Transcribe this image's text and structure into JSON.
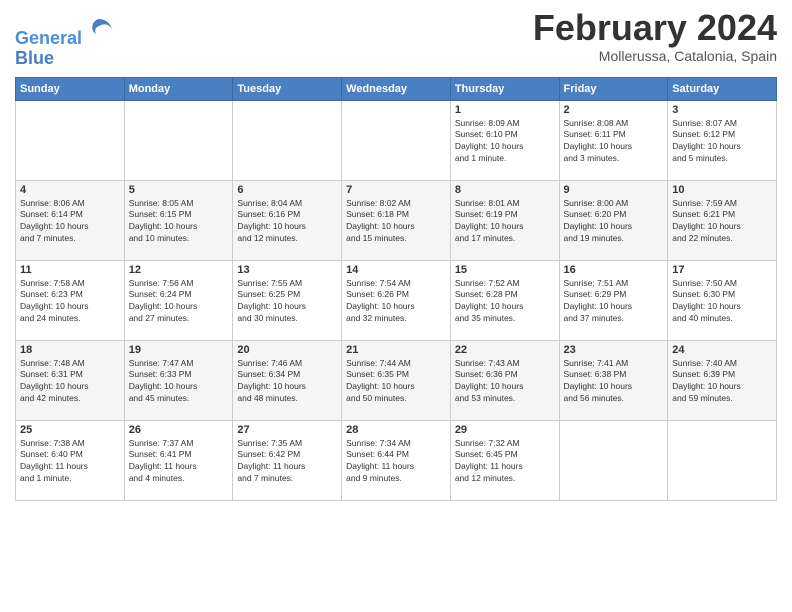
{
  "app": {
    "logo_line1": "General",
    "logo_line2": "Blue"
  },
  "header": {
    "title": "February 2024",
    "subtitle": "Mollerussa, Catalonia, Spain"
  },
  "days_of_week": [
    "Sunday",
    "Monday",
    "Tuesday",
    "Wednesday",
    "Thursday",
    "Friday",
    "Saturday"
  ],
  "weeks": [
    [
      {
        "day": "",
        "info": ""
      },
      {
        "day": "",
        "info": ""
      },
      {
        "day": "",
        "info": ""
      },
      {
        "day": "",
        "info": ""
      },
      {
        "day": "1",
        "info": "Sunrise: 8:09 AM\nSunset: 6:10 PM\nDaylight: 10 hours\nand 1 minute."
      },
      {
        "day": "2",
        "info": "Sunrise: 8:08 AM\nSunset: 6:11 PM\nDaylight: 10 hours\nand 3 minutes."
      },
      {
        "day": "3",
        "info": "Sunrise: 8:07 AM\nSunset: 6:12 PM\nDaylight: 10 hours\nand 5 minutes."
      }
    ],
    [
      {
        "day": "4",
        "info": "Sunrise: 8:06 AM\nSunset: 6:14 PM\nDaylight: 10 hours\nand 7 minutes."
      },
      {
        "day": "5",
        "info": "Sunrise: 8:05 AM\nSunset: 6:15 PM\nDaylight: 10 hours\nand 10 minutes."
      },
      {
        "day": "6",
        "info": "Sunrise: 8:04 AM\nSunset: 6:16 PM\nDaylight: 10 hours\nand 12 minutes."
      },
      {
        "day": "7",
        "info": "Sunrise: 8:02 AM\nSunset: 6:18 PM\nDaylight: 10 hours\nand 15 minutes."
      },
      {
        "day": "8",
        "info": "Sunrise: 8:01 AM\nSunset: 6:19 PM\nDaylight: 10 hours\nand 17 minutes."
      },
      {
        "day": "9",
        "info": "Sunrise: 8:00 AM\nSunset: 6:20 PM\nDaylight: 10 hours\nand 19 minutes."
      },
      {
        "day": "10",
        "info": "Sunrise: 7:59 AM\nSunset: 6:21 PM\nDaylight: 10 hours\nand 22 minutes."
      }
    ],
    [
      {
        "day": "11",
        "info": "Sunrise: 7:58 AM\nSunset: 6:23 PM\nDaylight: 10 hours\nand 24 minutes."
      },
      {
        "day": "12",
        "info": "Sunrise: 7:56 AM\nSunset: 6:24 PM\nDaylight: 10 hours\nand 27 minutes."
      },
      {
        "day": "13",
        "info": "Sunrise: 7:55 AM\nSunset: 6:25 PM\nDaylight: 10 hours\nand 30 minutes."
      },
      {
        "day": "14",
        "info": "Sunrise: 7:54 AM\nSunset: 6:26 PM\nDaylight: 10 hours\nand 32 minutes."
      },
      {
        "day": "15",
        "info": "Sunrise: 7:52 AM\nSunset: 6:28 PM\nDaylight: 10 hours\nand 35 minutes."
      },
      {
        "day": "16",
        "info": "Sunrise: 7:51 AM\nSunset: 6:29 PM\nDaylight: 10 hours\nand 37 minutes."
      },
      {
        "day": "17",
        "info": "Sunrise: 7:50 AM\nSunset: 6:30 PM\nDaylight: 10 hours\nand 40 minutes."
      }
    ],
    [
      {
        "day": "18",
        "info": "Sunrise: 7:48 AM\nSunset: 6:31 PM\nDaylight: 10 hours\nand 42 minutes."
      },
      {
        "day": "19",
        "info": "Sunrise: 7:47 AM\nSunset: 6:33 PM\nDaylight: 10 hours\nand 45 minutes."
      },
      {
        "day": "20",
        "info": "Sunrise: 7:46 AM\nSunset: 6:34 PM\nDaylight: 10 hours\nand 48 minutes."
      },
      {
        "day": "21",
        "info": "Sunrise: 7:44 AM\nSunset: 6:35 PM\nDaylight: 10 hours\nand 50 minutes."
      },
      {
        "day": "22",
        "info": "Sunrise: 7:43 AM\nSunset: 6:36 PM\nDaylight: 10 hours\nand 53 minutes."
      },
      {
        "day": "23",
        "info": "Sunrise: 7:41 AM\nSunset: 6:38 PM\nDaylight: 10 hours\nand 56 minutes."
      },
      {
        "day": "24",
        "info": "Sunrise: 7:40 AM\nSunset: 6:39 PM\nDaylight: 10 hours\nand 59 minutes."
      }
    ],
    [
      {
        "day": "25",
        "info": "Sunrise: 7:38 AM\nSunset: 6:40 PM\nDaylight: 11 hours\nand 1 minute."
      },
      {
        "day": "26",
        "info": "Sunrise: 7:37 AM\nSunset: 6:41 PM\nDaylight: 11 hours\nand 4 minutes."
      },
      {
        "day": "27",
        "info": "Sunrise: 7:35 AM\nSunset: 6:42 PM\nDaylight: 11 hours\nand 7 minutes."
      },
      {
        "day": "28",
        "info": "Sunrise: 7:34 AM\nSunset: 6:44 PM\nDaylight: 11 hours\nand 9 minutes."
      },
      {
        "day": "29",
        "info": "Sunrise: 7:32 AM\nSunset: 6:45 PM\nDaylight: 11 hours\nand 12 minutes."
      },
      {
        "day": "",
        "info": ""
      },
      {
        "day": "",
        "info": ""
      }
    ]
  ]
}
